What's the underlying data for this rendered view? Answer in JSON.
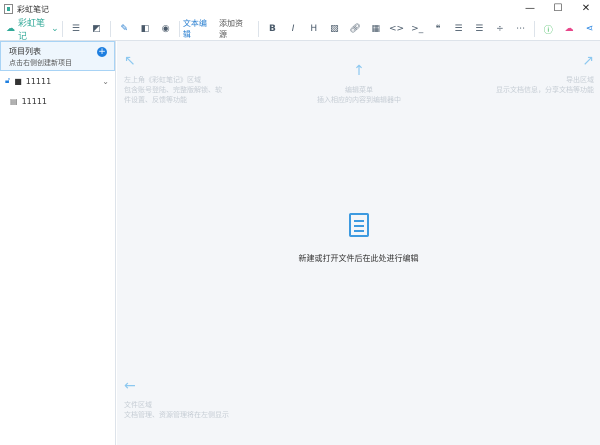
{
  "window": {
    "title": "彩虹笔记",
    "minimize": "—",
    "maximize": "☐",
    "close": "✕"
  },
  "toolbar": {
    "brand": "彩虹笔记",
    "text_edit": "文本编辑",
    "add_resource": "添加资源"
  },
  "sidebar": {
    "title": "项目列表",
    "subtitle": "点击右侧创建新项目",
    "add": "+",
    "project": "11111",
    "file": "11111"
  },
  "hints": {
    "top_left": {
      "title": "左上角《彩虹笔记》区域",
      "desc1": "包含账号登陆、完整版解锁、软",
      "desc2": "件设置、反馈等功能"
    },
    "top_center": {
      "title": "编辑菜单",
      "desc": "插入相应的内容到编辑器中"
    },
    "top_right": {
      "title": "导出区域",
      "desc": "显示文档信息，分享文档等功能"
    },
    "bottom_left": {
      "title": "文件区域",
      "desc": "文档管理、资源管理将在左侧显示"
    }
  },
  "center": {
    "message": "新建或打开文件后在此处进行编辑"
  },
  "colors": {
    "accent": "#1e7fe0",
    "brand": "#33aa99"
  }
}
